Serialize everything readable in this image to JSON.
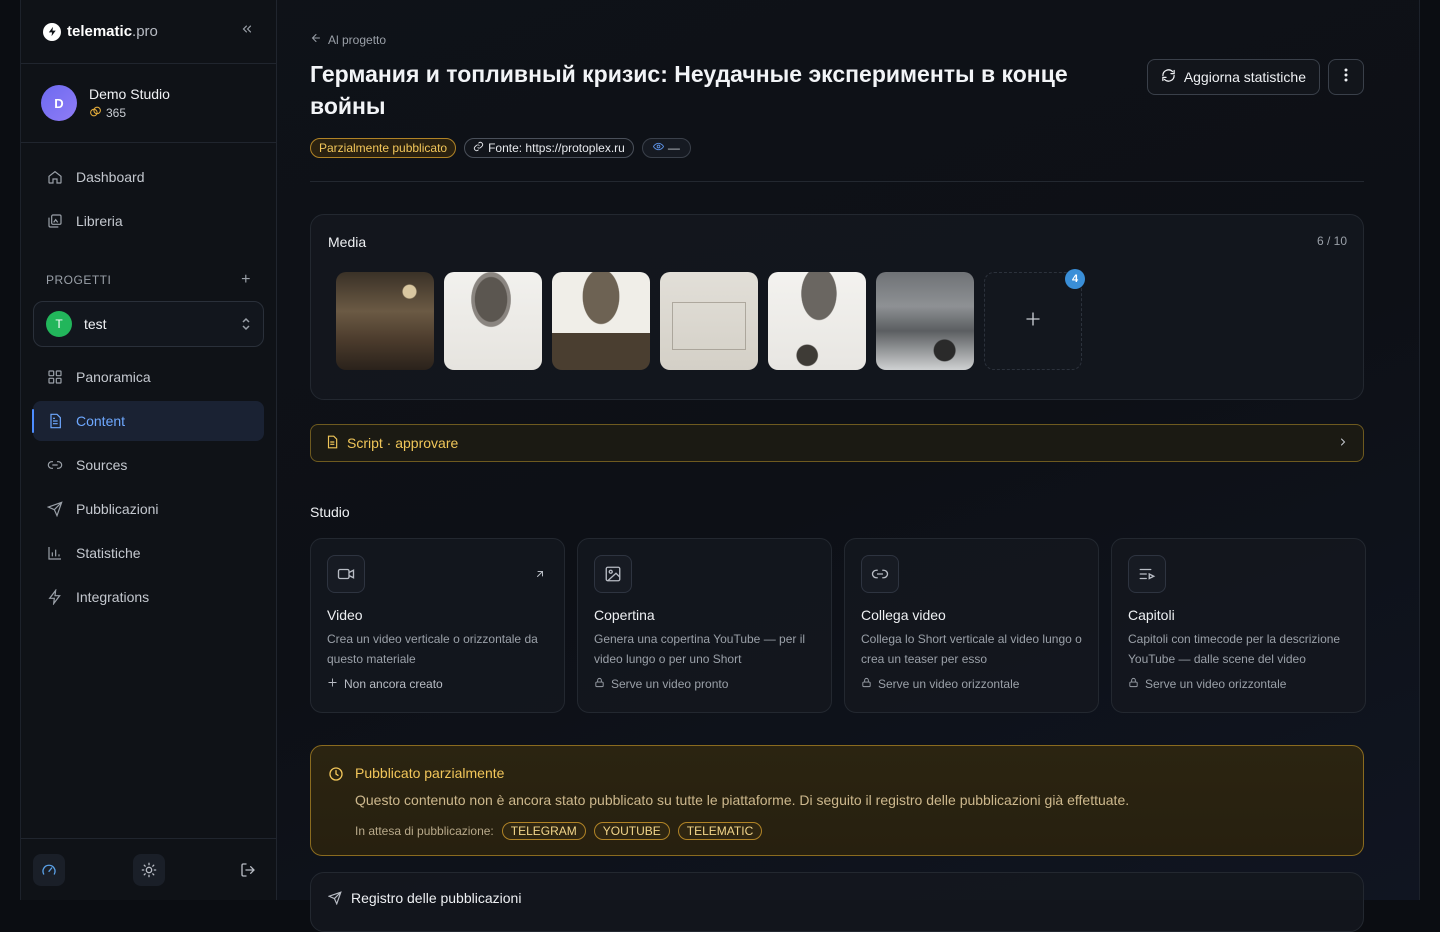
{
  "brand": {
    "name": "telematic",
    "suffix": ".pro"
  },
  "account": {
    "initial": "D",
    "name": "Demo Studio",
    "credits": "365"
  },
  "nav_top": [
    {
      "label": "Dashboard",
      "icon": "home-icon"
    },
    {
      "label": "Libreria",
      "icon": "library-icon"
    }
  ],
  "projects": {
    "heading": "PROGETTI",
    "selected_initial": "T",
    "selected": "test"
  },
  "nav_project": [
    {
      "label": "Panoramica",
      "icon": "grid-icon"
    },
    {
      "label": "Content",
      "icon": "document-icon",
      "active": true
    },
    {
      "label": "Sources",
      "icon": "link-icon"
    },
    {
      "label": "Pubblicazioni",
      "icon": "send-icon"
    },
    {
      "label": "Statistiche",
      "icon": "bar-chart-icon"
    },
    {
      "label": "Integrations",
      "icon": "bolt-icon"
    }
  ],
  "header": {
    "back": "Al progetto",
    "title": "Германия и топливный кризис: Неудачные эксперименты в конце войны",
    "refresh_label": "Aggiorna statistiche",
    "status_badge": "Parzialmente pubblicato",
    "source_badge": "Fonte: https://protoplex.ru",
    "views_badge": "—"
  },
  "media": {
    "heading": "Media",
    "count": "6 / 10",
    "add_badge": "4",
    "thumbnails": [
      "lab equipment photo",
      "document scan",
      "document scan",
      "technical drawing",
      "document scan",
      "truck photo"
    ]
  },
  "script_bar": {
    "label": "Script · approvare"
  },
  "studio": {
    "heading": "Studio",
    "cards": [
      {
        "title": "Video",
        "desc": "Crea un video verticale o orizzontale da questo materiale",
        "status": "Non ancora creato",
        "icon": "video-icon",
        "status_icon": "plus-icon"
      },
      {
        "title": "Copertina",
        "desc": "Genera una copertina YouTube — per il video lungo o per uno Short",
        "status": "Serve un video pronto",
        "icon": "image-icon",
        "status_icon": "lock-icon"
      },
      {
        "title": "Collega video",
        "desc": "Collega lo Short verticale al video lungo o crea un teaser per esso",
        "status": "Serve un video orizzontale",
        "icon": "link-icon",
        "status_icon": "lock-icon"
      },
      {
        "title": "Capitoli",
        "desc": "Capitoli con timecode per la descrizione YouTube — dalle scene del video",
        "status": "Serve un video orizzontale",
        "icon": "chapters-icon",
        "status_icon": "lock-icon"
      }
    ]
  },
  "partial_notice": {
    "title": "Pubblicato parzialmente",
    "text": "Questo contenuto non è ancora stato pubblicato su tutte le piattaforme. Di seguito il registro delle pubblicazioni già effettuate.",
    "pending_label": "In attesa di pubblicazione:",
    "platforms": [
      "TELEGRAM",
      "YOUTUBE",
      "TELEMATIC"
    ]
  },
  "registry": {
    "title": "Registro delle pubblicazioni"
  },
  "colors": {
    "accent": "#4d8dff",
    "warning": "#f2c65a",
    "success": "#22b65b"
  }
}
